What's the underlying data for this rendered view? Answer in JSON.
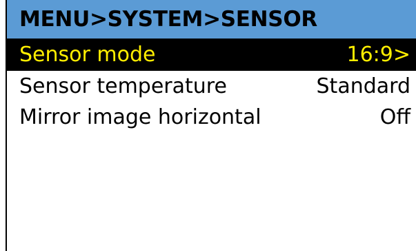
{
  "colors": {
    "header_bg": "#5b9bd5",
    "header_text": "#000000",
    "selected_bg": "#000000",
    "selected_text": "#ffee00",
    "item_text": "#000000",
    "background": "#ffffff"
  },
  "header": {
    "breadcrumb": "MENU>SYSTEM>SENSOR"
  },
  "items": [
    {
      "label": "Sensor mode",
      "value": "16:9>",
      "selected": true
    },
    {
      "label": "Sensor temperature",
      "value": "Standard",
      "selected": false
    },
    {
      "label": "Mirror image horizontal",
      "value": "Off",
      "selected": false
    }
  ]
}
